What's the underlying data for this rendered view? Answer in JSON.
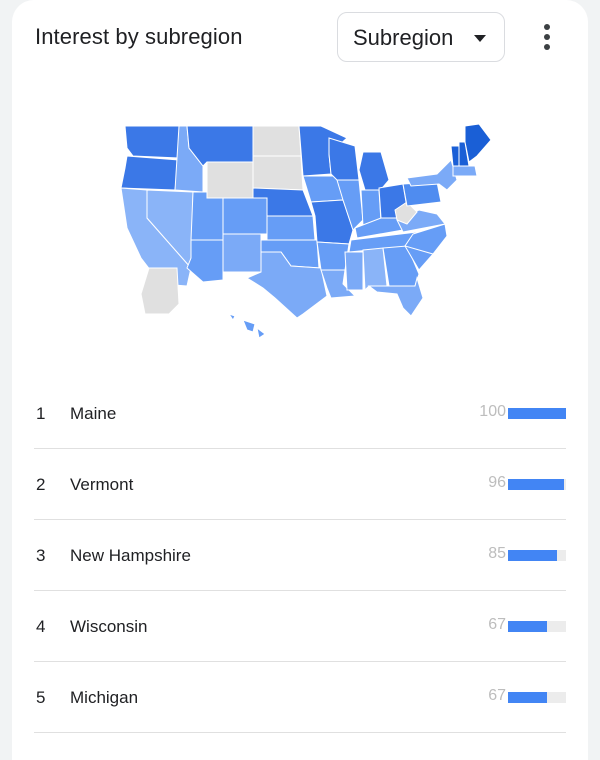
{
  "header": {
    "title": "Interest by subregion",
    "dropdown": {
      "selected": "Subregion",
      "icon": "caret-down-icon"
    },
    "menu_icon": "more-vert-icon"
  },
  "colors": {
    "accent": "#4285f4",
    "shade_levels": [
      "#e0e0e0",
      "#8ab4f8",
      "#7baaf7",
      "#669df6",
      "#4f8cf0",
      "#3b78e7",
      "#1a5fd6"
    ],
    "no_data": "#e0e0e0"
  },
  "map": {
    "region": "United States",
    "states": [
      {
        "name": "Washington",
        "level": 5
      },
      {
        "name": "Oregon",
        "level": 5
      },
      {
        "name": "California",
        "level": 1
      },
      {
        "name": "Nevada",
        "level": 1
      },
      {
        "name": "Idaho",
        "level": 2
      },
      {
        "name": "Montana",
        "level": 5
      },
      {
        "name": "Wyoming",
        "level": 0
      },
      {
        "name": "Utah",
        "level": 3
      },
      {
        "name": "Arizona",
        "level": 3
      },
      {
        "name": "Colorado",
        "level": 3
      },
      {
        "name": "New Mexico",
        "level": 2
      },
      {
        "name": "North Dakota",
        "level": 0
      },
      {
        "name": "South Dakota",
        "level": 0
      },
      {
        "name": "Nebraska",
        "level": 5
      },
      {
        "name": "Kansas",
        "level": 3
      },
      {
        "name": "Oklahoma",
        "level": 3
      },
      {
        "name": "Texas",
        "level": 2
      },
      {
        "name": "Minnesota",
        "level": 5
      },
      {
        "name": "Iowa",
        "level": 3
      },
      {
        "name": "Missouri",
        "level": 5
      },
      {
        "name": "Arkansas",
        "level": 3
      },
      {
        "name": "Louisiana",
        "level": 2
      },
      {
        "name": "Wisconsin",
        "level": 5
      },
      {
        "name": "Illinois",
        "level": 3
      },
      {
        "name": "Michigan",
        "level": 5
      },
      {
        "name": "Indiana",
        "level": 3
      },
      {
        "name": "Ohio",
        "level": 5
      },
      {
        "name": "Kentucky",
        "level": 3
      },
      {
        "name": "Tennessee",
        "level": 3
      },
      {
        "name": "Mississippi",
        "level": 2
      },
      {
        "name": "Alabama",
        "level": 1
      },
      {
        "name": "Georgia",
        "level": 3
      },
      {
        "name": "Florida",
        "level": 2
      },
      {
        "name": "South Carolina",
        "level": 3
      },
      {
        "name": "North Carolina",
        "level": 3
      },
      {
        "name": "Virginia",
        "level": 2
      },
      {
        "name": "West Virginia",
        "level": 0
      },
      {
        "name": "Pennsylvania",
        "level": 4
      },
      {
        "name": "New York",
        "level": 2
      },
      {
        "name": "Vermont",
        "level": 6
      },
      {
        "name": "New Hampshire",
        "level": 6
      },
      {
        "name": "Maine",
        "level": 6
      },
      {
        "name": "Massachusetts",
        "level": 2
      },
      {
        "name": "Alaska",
        "level": 0
      },
      {
        "name": "Hawaii",
        "level": 3
      }
    ]
  },
  "ranking": {
    "max": 100,
    "rows": [
      {
        "rank": "1",
        "name": "Maine",
        "value": 100
      },
      {
        "rank": "2",
        "name": "Vermont",
        "value": 96
      },
      {
        "rank": "3",
        "name": "New Hampshire",
        "value": 85
      },
      {
        "rank": "4",
        "name": "Wisconsin",
        "value": 67
      },
      {
        "rank": "5",
        "name": "Michigan",
        "value": 67
      }
    ]
  }
}
